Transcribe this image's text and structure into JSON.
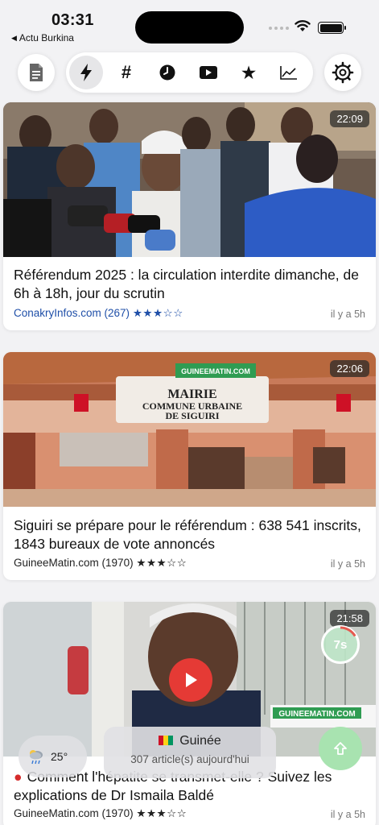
{
  "status": {
    "time": "03:31",
    "back_label": "Actu Burkina"
  },
  "toolbar": {
    "tabs": [
      "flash",
      "hashtag",
      "clock",
      "video",
      "star",
      "trend"
    ]
  },
  "articles": [
    {
      "time": "22:09",
      "title": "Référendum 2025 : la circulation interdite dimanche, de 6h à 18h, jour du scrutin",
      "source": "ConakryInfos.com (267)",
      "stars": "★★★☆☆",
      "ago": "il y a 5h"
    },
    {
      "time": "22:06",
      "title": "Siguiri se prépare pour le référendum : 638 541 inscrits, 1843 bureaux de vote annoncés",
      "source": "GuineeMatin.com (1970)",
      "stars": "★★★☆☆",
      "ago": "il y a 5h",
      "photo_text": {
        "top": "GUINEEMATIN.COM",
        "l1": "MAIRIE",
        "l2": "COMMUNE URBAINE",
        "l3": "DE SIGUIRI"
      }
    },
    {
      "time": "21:58",
      "title": "Comment l'hépatite se transmet-elle ? Suivez les explications de Dr Ismaila Baldé",
      "source": "GuineeMatin.com (1970)",
      "stars": "★★★☆☆",
      "ago": "il y a 5h",
      "photo_text": {
        "banner": "GUINEEMATIN.COM"
      }
    }
  ],
  "floating": {
    "weather_temp": "25°",
    "country": "Guinée",
    "count": "307 article(s) aujourd'hui",
    "timer": "7s"
  },
  "colors": {
    "accent_blue": "#1f4fa8",
    "play_red": "#e53a35",
    "up_green": "#a8e3b0"
  }
}
